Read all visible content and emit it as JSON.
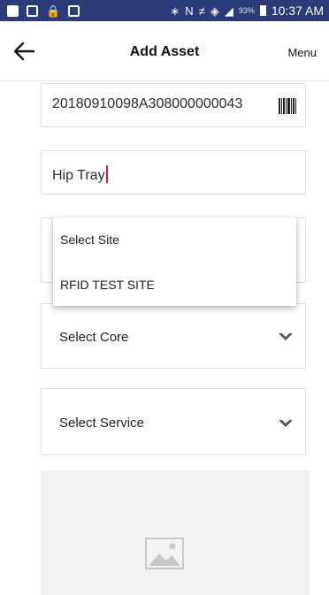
{
  "status_bar": {
    "battery": "93%",
    "time": "10:37 AM",
    "color": "#2b3a78"
  },
  "header": {
    "title": "Add Asset",
    "menu_label": "Menu",
    "back_icon": "arrow-left-icon"
  },
  "form": {
    "asset_id": "20180910098A308000000043",
    "asset_name": "Hip Tray",
    "site_placeholder": "Select Site",
    "core_label": "Select Core",
    "service_label": "Select Service"
  },
  "site_dropdown": {
    "options": [
      "Select Site",
      "RFID TEST SITE"
    ]
  },
  "image_placeholder": {
    "icon": "image-icon"
  },
  "colors": {
    "cursor": "#c2185b",
    "border": "#dedede"
  }
}
